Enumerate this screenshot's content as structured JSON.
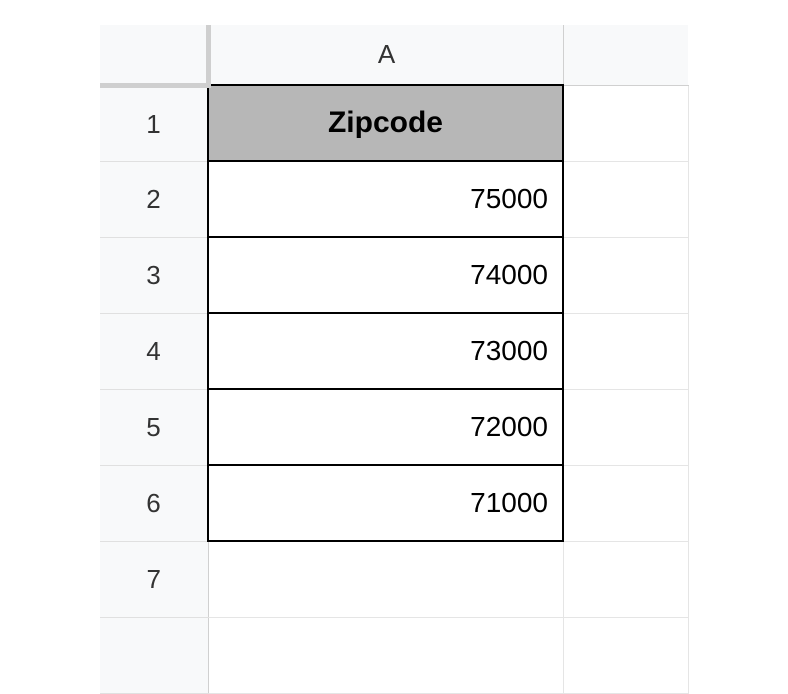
{
  "columns": {
    "a": "A"
  },
  "rows": {
    "r1": "1",
    "r2": "2",
    "r3": "3",
    "r4": "4",
    "r5": "5",
    "r6": "6",
    "r7": "7"
  },
  "cells": {
    "a1": "Zipcode",
    "a2": "75000",
    "a3": "74000",
    "a4": "73000",
    "a5": "72000",
    "a6": "71000",
    "a7": ""
  }
}
